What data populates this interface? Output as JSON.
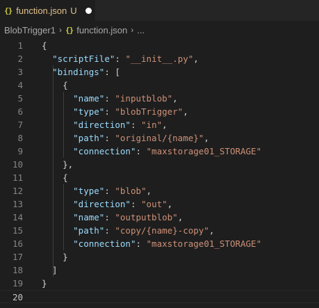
{
  "tab": {
    "icon": "{}",
    "filename": "function.json",
    "status": "U"
  },
  "breadcrumb": {
    "folder": "BlobTrigger1",
    "file_icon": "{}",
    "file": "function.json",
    "more": "..."
  },
  "editor": {
    "lines": [
      {
        "n": "1",
        "tokens": [
          {
            "t": "{",
            "c": "p"
          }
        ]
      },
      {
        "n": "2",
        "tokens": [
          {
            "t": "  ",
            "c": "p"
          },
          {
            "t": "\"scriptFile\"",
            "c": "k"
          },
          {
            "t": ": ",
            "c": "p"
          },
          {
            "t": "\"__init__.py\"",
            "c": "s"
          },
          {
            "t": ",",
            "c": "p"
          }
        ]
      },
      {
        "n": "3",
        "tokens": [
          {
            "t": "  ",
            "c": "p"
          },
          {
            "t": "\"bindings\"",
            "c": "k"
          },
          {
            "t": ": [",
            "c": "p"
          }
        ]
      },
      {
        "n": "4",
        "tokens": [
          {
            "t": "    {",
            "c": "p"
          }
        ]
      },
      {
        "n": "5",
        "tokens": [
          {
            "t": "      ",
            "c": "p"
          },
          {
            "t": "\"name\"",
            "c": "k"
          },
          {
            "t": ": ",
            "c": "p"
          },
          {
            "t": "\"inputblob\"",
            "c": "s"
          },
          {
            "t": ",",
            "c": "p"
          }
        ]
      },
      {
        "n": "6",
        "tokens": [
          {
            "t": "      ",
            "c": "p"
          },
          {
            "t": "\"type\"",
            "c": "k"
          },
          {
            "t": ": ",
            "c": "p"
          },
          {
            "t": "\"blobTrigger\"",
            "c": "s"
          },
          {
            "t": ",",
            "c": "p"
          }
        ]
      },
      {
        "n": "7",
        "tokens": [
          {
            "t": "      ",
            "c": "p"
          },
          {
            "t": "\"direction\"",
            "c": "k"
          },
          {
            "t": ": ",
            "c": "p"
          },
          {
            "t": "\"in\"",
            "c": "s"
          },
          {
            "t": ",",
            "c": "p"
          }
        ]
      },
      {
        "n": "8",
        "tokens": [
          {
            "t": "      ",
            "c": "p"
          },
          {
            "t": "\"path\"",
            "c": "k"
          },
          {
            "t": ": ",
            "c": "p"
          },
          {
            "t": "\"original/{name}\"",
            "c": "s"
          },
          {
            "t": ",",
            "c": "p"
          }
        ]
      },
      {
        "n": "9",
        "tokens": [
          {
            "t": "      ",
            "c": "p"
          },
          {
            "t": "\"connection\"",
            "c": "k"
          },
          {
            "t": ": ",
            "c": "p"
          },
          {
            "t": "\"maxstorage01_STORAGE\"",
            "c": "s"
          }
        ]
      },
      {
        "n": "10",
        "tokens": [
          {
            "t": "    },",
            "c": "p"
          }
        ]
      },
      {
        "n": "11",
        "tokens": [
          {
            "t": "    {",
            "c": "p"
          }
        ]
      },
      {
        "n": "12",
        "tokens": [
          {
            "t": "      ",
            "c": "p"
          },
          {
            "t": "\"type\"",
            "c": "k"
          },
          {
            "t": ": ",
            "c": "p"
          },
          {
            "t": "\"blob\"",
            "c": "s"
          },
          {
            "t": ",",
            "c": "p"
          }
        ]
      },
      {
        "n": "13",
        "tokens": [
          {
            "t": "      ",
            "c": "p"
          },
          {
            "t": "\"direction\"",
            "c": "k"
          },
          {
            "t": ": ",
            "c": "p"
          },
          {
            "t": "\"out\"",
            "c": "s"
          },
          {
            "t": ",",
            "c": "p"
          }
        ]
      },
      {
        "n": "14",
        "tokens": [
          {
            "t": "      ",
            "c": "p"
          },
          {
            "t": "\"name\"",
            "c": "k"
          },
          {
            "t": ": ",
            "c": "p"
          },
          {
            "t": "\"outputblob\"",
            "c": "s"
          },
          {
            "t": ",",
            "c": "p"
          }
        ]
      },
      {
        "n": "15",
        "tokens": [
          {
            "t": "      ",
            "c": "p"
          },
          {
            "t": "\"path\"",
            "c": "k"
          },
          {
            "t": ": ",
            "c": "p"
          },
          {
            "t": "\"copy/{name}-copy\"",
            "c": "s"
          },
          {
            "t": ",",
            "c": "p"
          }
        ]
      },
      {
        "n": "16",
        "tokens": [
          {
            "t": "      ",
            "c": "p"
          },
          {
            "t": "\"connection\"",
            "c": "k"
          },
          {
            "t": ": ",
            "c": "p"
          },
          {
            "t": "\"maxstorage01_STORAGE\"",
            "c": "s"
          }
        ]
      },
      {
        "n": "17",
        "tokens": [
          {
            "t": "    }",
            "c": "p"
          }
        ]
      },
      {
        "n": "18",
        "tokens": [
          {
            "t": "  ]",
            "c": "p"
          }
        ]
      },
      {
        "n": "19",
        "tokens": [
          {
            "t": "}",
            "c": "p"
          }
        ]
      },
      {
        "n": "20",
        "tokens": []
      }
    ]
  }
}
